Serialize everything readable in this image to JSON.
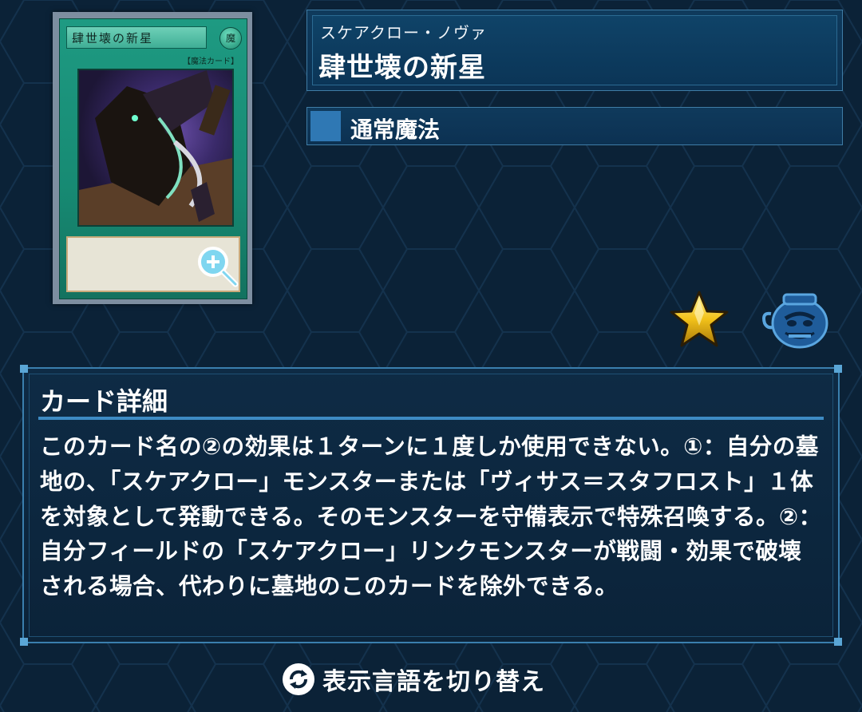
{
  "card": {
    "ruby": "スケアクロー・ノヴァ",
    "name": "肆世壊の新星",
    "card_image_name": "肆世壊の新星",
    "card_image_type": "【魔法カード】",
    "type": "通常魔法"
  },
  "detail": {
    "title": "カード詳細",
    "text": "このカード名の②の効果は１ターンに１度しか使用できない。①：自分の墓地の、「スケアクロー」モンスターまたは「ヴィサス＝スタフロスト」１体を対象として発動できる。そのモンスターを守備表示で特殊召喚する。②：自分フィールドの「スケアクロー」リンクモンスターが戦闘・効果で破壊される場合、代わりに墓地のこのカードを除外できる。"
  },
  "toggle": {
    "label": "表示言語を切り替え"
  },
  "icons": {
    "zoom": "zoom-in-icon",
    "rarity": "rarity-star-icon",
    "collection": "pot-of-greed-icon",
    "toggle": "language-switch-icon"
  },
  "colors": {
    "background": "#0b2237",
    "panel_border": "#3f7da6",
    "accent": "#2f78b4",
    "card_green": "#1e9a82"
  }
}
